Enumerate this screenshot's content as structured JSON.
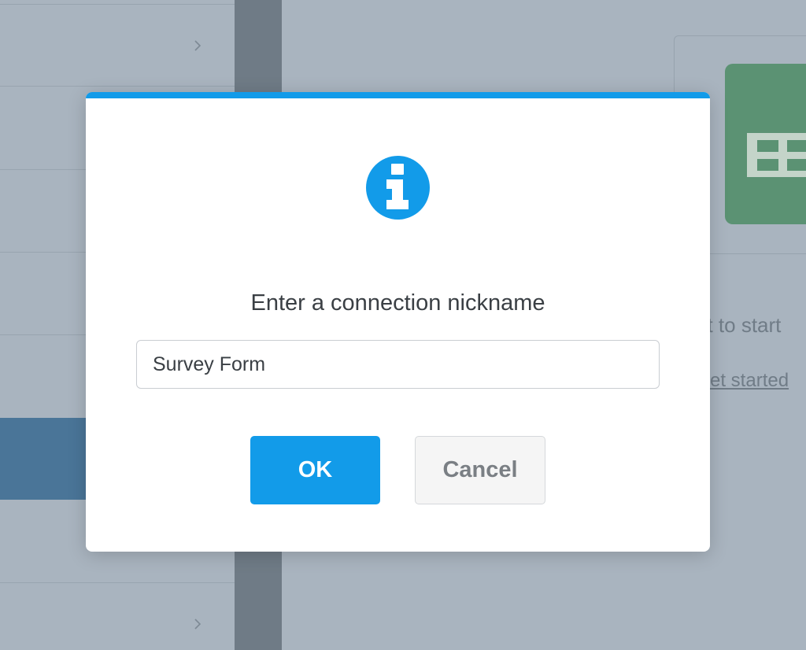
{
  "background": {
    "content_text_fragment": "et to start",
    "content_link_fragment": "et started"
  },
  "dialog": {
    "icon": "info-icon",
    "title": "Enter a connection nickname",
    "input_value": "Survey Form",
    "ok_label": "OK",
    "cancel_label": "Cancel"
  },
  "colors": {
    "accent": "#129be9",
    "overlay": "#a9b4bf",
    "sidebar_active": "#4a7598",
    "sheets_green": "#5b9273"
  }
}
